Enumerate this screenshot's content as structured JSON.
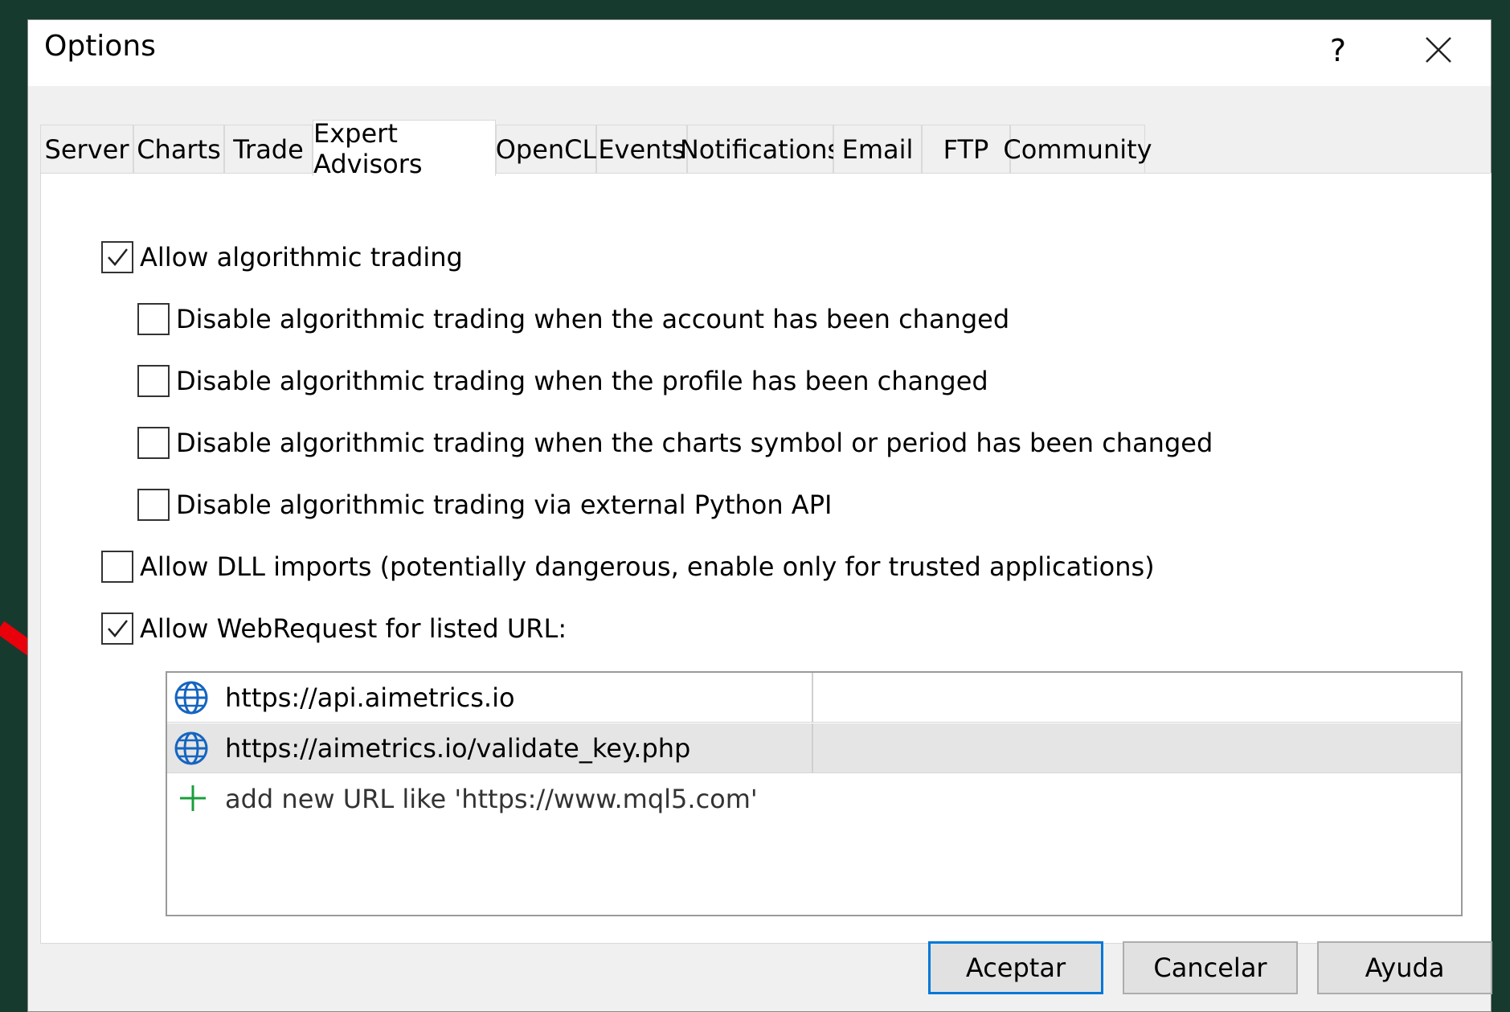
{
  "window": {
    "title": "Options",
    "help_label": "?",
    "close_icon": "close-icon"
  },
  "tabs": [
    {
      "label": "Server"
    },
    {
      "label": "Charts"
    },
    {
      "label": "Trade"
    },
    {
      "label": "Expert Advisors",
      "active": true
    },
    {
      "label": "OpenCL"
    },
    {
      "label": "Events"
    },
    {
      "label": "Notifications"
    },
    {
      "label": "Email"
    },
    {
      "label": "FTP"
    },
    {
      "label": "Community"
    }
  ],
  "options": {
    "allow_algo": {
      "label": "Allow algorithmic trading",
      "checked": true
    },
    "disable_account": {
      "label": "Disable algorithmic trading when the account has been changed",
      "checked": false
    },
    "disable_profile": {
      "label": "Disable algorithmic trading when the profile has been changed",
      "checked": false
    },
    "disable_symbol": {
      "label": "Disable algorithmic trading when the charts symbol or period has been changed",
      "checked": false
    },
    "disable_python": {
      "label": "Disable algorithmic trading via external Python API",
      "checked": false
    },
    "allow_dll": {
      "label": "Allow DLL imports (potentially dangerous, enable only for trusted applications)",
      "checked": false
    },
    "allow_webrequest": {
      "label": "Allow WebRequest for listed URL:",
      "checked": true
    }
  },
  "url_list": {
    "urls": [
      {
        "url": "https://api.aimetrics.io",
        "icon": "globe-icon"
      },
      {
        "url": "https://aimetrics.io/validate_key.php",
        "icon": "globe-icon",
        "selected": true
      }
    ],
    "add_placeholder": "add new URL like 'https://www.mql5.com'",
    "add_icon": "plus-icon"
  },
  "buttons": {
    "ok": "Aceptar",
    "cancel": "Cancelar",
    "help": "Ayuda"
  },
  "colors": {
    "background": "#163a2e",
    "dialog": "#f0f0f0",
    "primary_border": "#0078d7",
    "annotation_arrow": "#e8000b",
    "plus_green": "#1a9e3a"
  }
}
